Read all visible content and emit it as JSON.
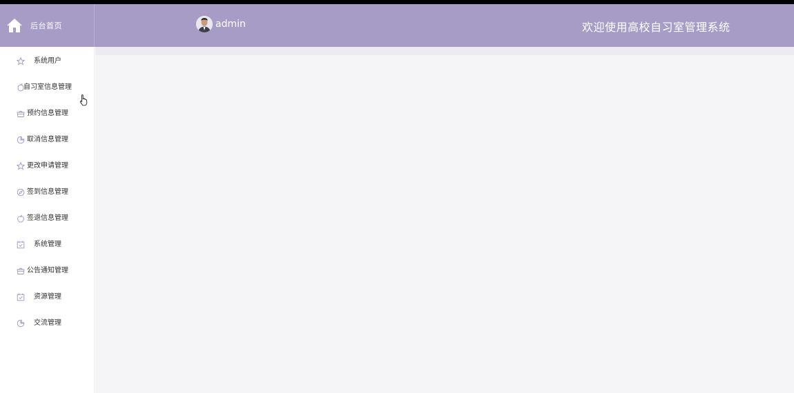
{
  "header": {
    "home_label": "后台首页",
    "username": "admin",
    "welcome": "欢迎使用高校自习室管理系统"
  },
  "sidebar": {
    "items": [
      {
        "label": "系统用户",
        "icon": "star-icon",
        "indent": true
      },
      {
        "label": "自习室信息管理",
        "icon": "lemon-icon",
        "indent": false
      },
      {
        "label": "预约信息管理",
        "icon": "basket-icon",
        "indent": false
      },
      {
        "label": "取消信息管理",
        "icon": "pie-chart-icon",
        "indent": false
      },
      {
        "label": "更改申请管理",
        "icon": "star-icon",
        "indent": false
      },
      {
        "label": "签到信息管理",
        "icon": "compass-icon",
        "indent": false
      },
      {
        "label": "签退信息管理",
        "icon": "apple-icon",
        "indent": false
      },
      {
        "label": "系统管理",
        "icon": "calendar-check-icon",
        "indent": true
      },
      {
        "label": "公告通知管理",
        "icon": "basket-icon",
        "indent": false
      },
      {
        "label": "资源管理",
        "icon": "calendar-check-icon",
        "indent": true
      },
      {
        "label": "交流管理",
        "icon": "pie-chart-icon",
        "indent": true
      }
    ]
  },
  "colors": {
    "header_bg": "#a69cc6",
    "content_bg": "#f5f5f8",
    "icon_color": "#9d95c0"
  }
}
